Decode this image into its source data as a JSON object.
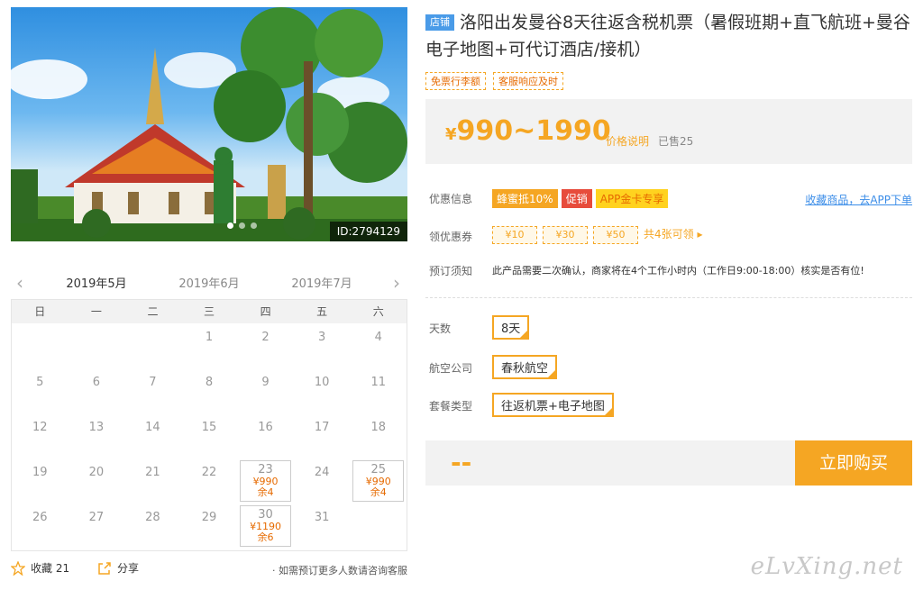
{
  "hero": {
    "id_text": "ID:2794129"
  },
  "calendar": {
    "months": [
      "2019年5月",
      "2019年6月",
      "2019年7月"
    ],
    "weekdays": [
      "日",
      "一",
      "二",
      "三",
      "四",
      "五",
      "六"
    ],
    "weeks": [
      [
        {
          "d": ""
        },
        {
          "d": ""
        },
        {
          "d": ""
        },
        {
          "d": "1"
        },
        {
          "d": "2"
        },
        {
          "d": "3"
        },
        {
          "d": "4"
        }
      ],
      [
        {
          "d": "5"
        },
        {
          "d": "6"
        },
        {
          "d": "7"
        },
        {
          "d": "8"
        },
        {
          "d": "9"
        },
        {
          "d": "10"
        },
        {
          "d": "11"
        }
      ],
      [
        {
          "d": "12"
        },
        {
          "d": "13"
        },
        {
          "d": "14"
        },
        {
          "d": "15"
        },
        {
          "d": "16"
        },
        {
          "d": "17"
        },
        {
          "d": "18"
        }
      ],
      [
        {
          "d": "19"
        },
        {
          "d": "20"
        },
        {
          "d": "21"
        },
        {
          "d": "22"
        },
        {
          "d": "23",
          "price": "¥990",
          "stock": "余4"
        },
        {
          "d": "24"
        },
        {
          "d": "25",
          "price": "¥990",
          "stock": "余4"
        }
      ],
      [
        {
          "d": "26"
        },
        {
          "d": "27"
        },
        {
          "d": "28"
        },
        {
          "d": "29"
        },
        {
          "d": "30",
          "price": "¥1190",
          "stock": "余6"
        },
        {
          "d": "31"
        },
        {
          "d": ""
        }
      ]
    ]
  },
  "footer": {
    "fav_label": "收藏 21",
    "share_label": "分享",
    "note": "· 如需预订更多人数请咨询客服"
  },
  "product": {
    "shop_badge": "店铺",
    "title": "洛阳出发曼谷8天往返含税机票（暑假班期+直飞航班+曼谷电子地图+可代订酒店/接机）",
    "tags": [
      "免票行李额",
      "客服响应及时"
    ],
    "price_symbol": "¥",
    "price": "990~1990",
    "price_explain": "价格说明",
    "sold": "已售25"
  },
  "promo": {
    "label": "优惠信息",
    "badges": [
      "蜂蜜抵10%",
      "促销",
      "APP金卡专享"
    ],
    "fav_link": "收藏商品，去APP下单"
  },
  "coupons": {
    "label": "领优惠券",
    "items": [
      "¥10",
      "¥30",
      "¥50"
    ],
    "more": "共4张可领 ▸"
  },
  "notice": {
    "label": "预订须知",
    "text": "此产品需要二次确认，商家将在4个工作小时内（工作日9:00-18:00）核实是否有位!"
  },
  "options": {
    "days_label": "天数",
    "days_value": "8天",
    "airline_label": "航空公司",
    "airline_value": "春秋航空",
    "package_label": "套餐类型",
    "package_value": "往返机票+电子地图"
  },
  "buy": {
    "placeholder_price": "--",
    "button": "立即购买"
  },
  "watermark": "eLvXing.net",
  "colors": {
    "accent": "#f5a623",
    "link": "#3b8de8",
    "red": "#e74c3c"
  }
}
